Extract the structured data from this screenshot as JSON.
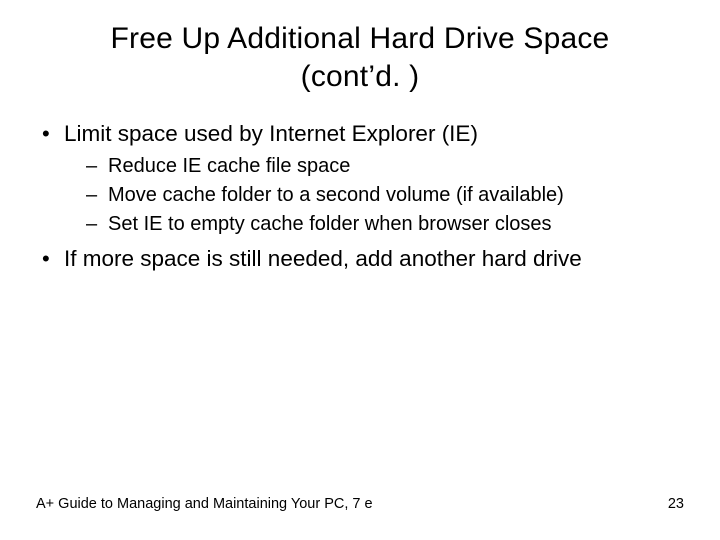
{
  "title_line1": "Free Up Additional Hard Drive Space",
  "title_line2": "(cont’d. )",
  "bullets": {
    "b1": "Limit space used by Internet Explorer (IE)",
    "b1_sub": {
      "s1": "Reduce IE cache file space",
      "s2": "Move cache folder to a second volume (if available)",
      "s3": "Set IE to empty cache folder when browser closes"
    },
    "b2": "If more space is still needed, add another hard drive"
  },
  "footer": {
    "left": "A+ Guide to Managing and Maintaining Your PC, 7 e",
    "right": "23"
  }
}
